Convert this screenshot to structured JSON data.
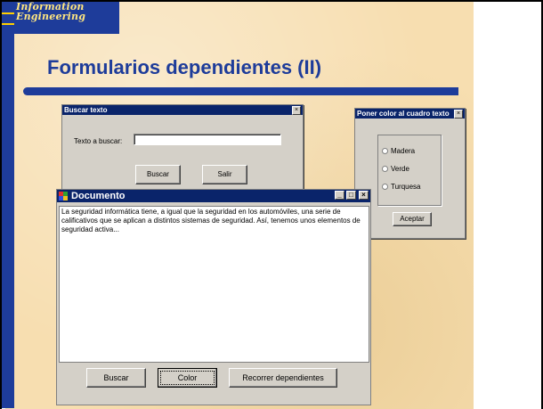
{
  "logo": {
    "line1": "Information",
    "line2": "Engineering"
  },
  "slide": {
    "title": "Formularios dependientes (II)"
  },
  "buscar_window": {
    "title": "Buscar texto",
    "close": "×",
    "label": "Texto a buscar:",
    "input_value": "",
    "buttons": [
      "Buscar",
      "Salir"
    ]
  },
  "color_window": {
    "title": "Poner color al cuadro texto",
    "close": "×",
    "options": [
      "Madera",
      "Verde",
      "Turquesa"
    ],
    "button": "Aceptar"
  },
  "documento_window": {
    "title": "Documento",
    "controls": [
      "_",
      "□",
      "×"
    ],
    "text": "La seguridad informática tiene, a igual que la seguridad en los automóviles, una serie de calificativos que se aplican a distintos sistemas de seguridad. Así, tenemos unos elementos de seguridad activa...",
    "buttons": [
      "Buscar",
      "Color",
      "Recorrer dependientes"
    ]
  },
  "colors": {
    "accent": "#1e3c9a",
    "titlebar": "#0a246a",
    "parchment": "#f7deb0",
    "face": "#d4d0c8"
  }
}
